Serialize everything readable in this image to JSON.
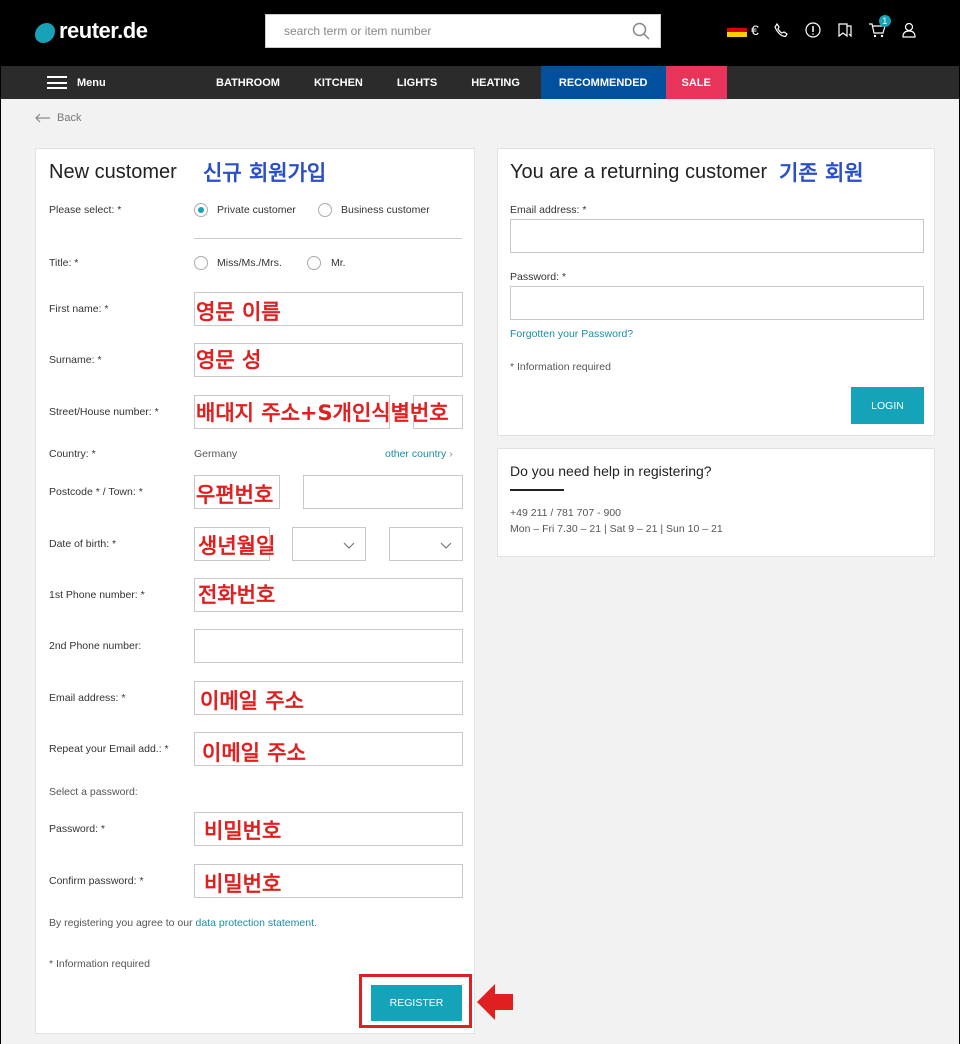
{
  "header": {
    "logo_text": "reuter.de",
    "search_placeholder": "search term or item number",
    "currency": "€",
    "cart_count": "1"
  },
  "nav": {
    "menu_label": "Menu",
    "items": [
      "BATHROOM",
      "KITCHEN",
      "LIGHTS",
      "HEATING",
      "RECOMMENDED",
      "SALE"
    ]
  },
  "back_label": "Back",
  "new_customer": {
    "title": "New customer",
    "annotation": "신규 회원가입",
    "please_select_label": "Please select: *",
    "customer_type_options": [
      "Private customer",
      "Business customer"
    ],
    "title_label": "Title: *",
    "title_options": [
      "Miss/Ms./Mrs.",
      "Mr."
    ],
    "first_name_label": "First name: *",
    "first_name_note": "영문 이름",
    "surname_label": "Surname: *",
    "surname_note": "영문 성",
    "street_label": "Street/House number: *",
    "street_note": "배대지 주소+S개인식별번호",
    "country_label": "Country: *",
    "country_value": "Germany",
    "other_country": "other country",
    "postcode_label": "Postcode * / Town: *",
    "postcode_note": "우편번호",
    "dob_label": "Date of birth: *",
    "dob_note": "생년월일",
    "phone1_label": "1st Phone number: *",
    "phone1_note": "전화번호",
    "phone2_label": "2nd Phone number:",
    "email_label": "Email address: *",
    "email_note": "이메일 주소",
    "email_repeat_label": "Repeat your Email add.: *",
    "email_repeat_note": "이메일 주소",
    "select_password": "Select a password:",
    "password_label": "Password: *",
    "password_note": "비밀번호",
    "confirm_label": "Confirm password: *",
    "confirm_note": "비밀번호",
    "agree_text": "By registering you agree to our ",
    "agree_link": "data protection statement.",
    "info_required": "* Information required",
    "register_label": "REGISTER"
  },
  "returning": {
    "title": "You are a returning customer",
    "annotation": "기존 회원",
    "email_label": "Email address: *",
    "password_label": "Password: *",
    "forgot_link": "Forgotten your Password?",
    "info_required": "* Information required",
    "login_label": "LOGIN"
  },
  "help": {
    "title": "Do you need help in registering?",
    "phone": "+49 211 / 781 707 - 900",
    "hours": "Mon – Fri 7.30 – 21 | Sat 9 – 21 | Sun 10 – 21"
  },
  "colors": {
    "accent": "#14a3b8",
    "sale": "#e8335a",
    "recommended": "#00509e",
    "annotation_red": "#e02020",
    "annotation_blue": "#2b4fc4"
  }
}
